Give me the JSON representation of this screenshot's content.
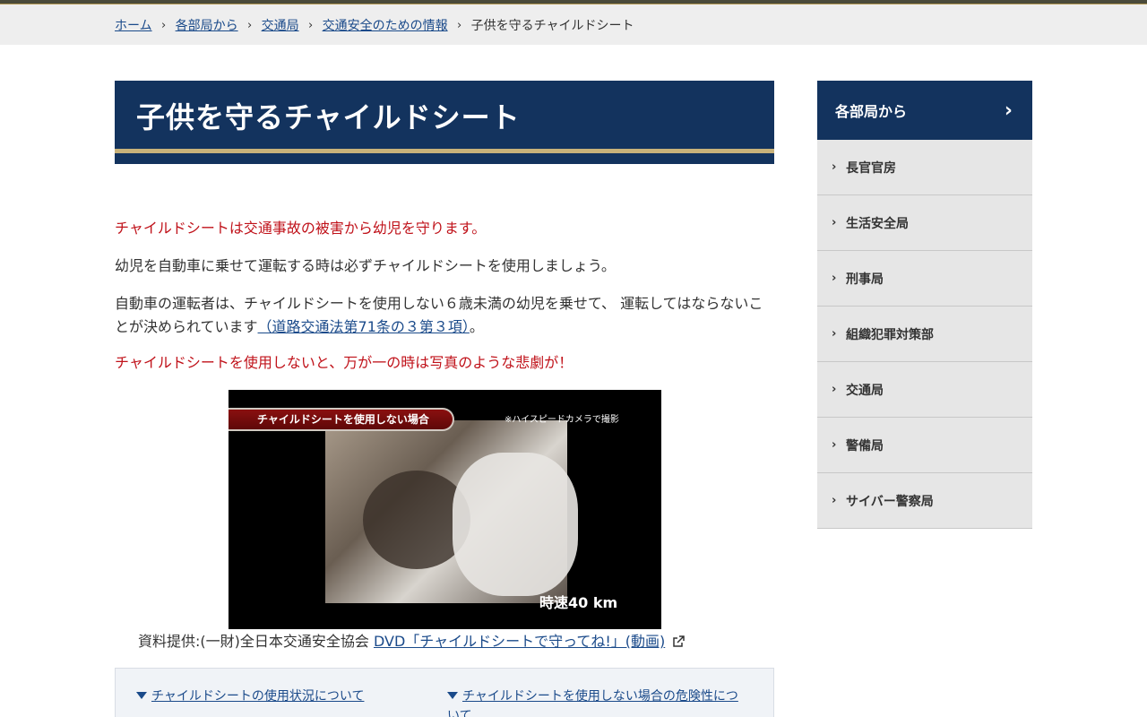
{
  "breadcrumb": {
    "items": [
      "ホーム",
      "各部局から",
      "交通局",
      "交通安全のための情報"
    ],
    "current": "子供を守るチャイルドシート"
  },
  "page": {
    "title": "子供を守るチャイルドシート"
  },
  "content": {
    "p1": "チャイルドシートは交通事故の被害から幼児を守ります。",
    "p2": "幼児を自動車に乗せて運転する時は必ずチャイルドシートを使用しましょう。",
    "p3_text": "自動車の運転者は、チャイルドシートを使用しない６歳未満の幼児を乗せて、 運転してはならないことが決められています",
    "p3_link": "（道路交通法第71条の３第３項）",
    "p3_end": "。",
    "p4": "チャイルドシートを使用しないと、万が一の時は写真のような悲劇が！"
  },
  "video": {
    "banner": "チャイルドシートを使用しない場合",
    "camera_note": "※ハイスピードカメラで撮影",
    "speed": "時速40 km"
  },
  "caption": {
    "text": "資料提供:(一財)全日本交通安全協会 ",
    "link": "DVD「チャイルドシートで守ってね!」(動画)"
  },
  "toc": {
    "items": [
      "チャイルドシートの使用状況について",
      "チャイルドシートを使用しない場合の危険性について"
    ]
  },
  "sidebar": {
    "heading": "各部局から",
    "items": [
      "長官官房",
      "生活安全局",
      "刑事局",
      "組織犯罪対策部",
      "交通局",
      "警備局",
      "サイバー警察局"
    ]
  },
  "colors": {
    "navy": "#13335e",
    "gold": "#c8b27a",
    "red_text": "#c0121a",
    "link": "#1a4a8a"
  }
}
